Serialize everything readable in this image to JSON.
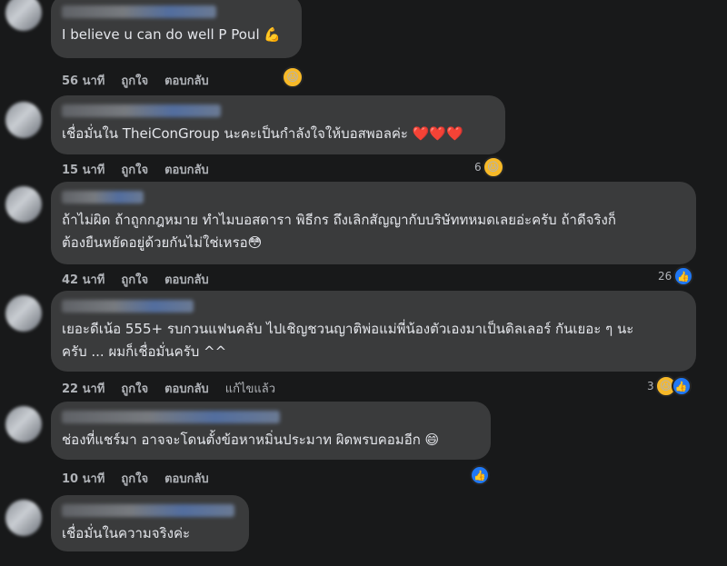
{
  "comments": [
    {
      "text": "I believe u can do well P Poul 💪",
      "time": "56 นาที",
      "like": "ถูกใจ",
      "reply": "ตอบกลับ",
      "reaction_count": ""
    },
    {
      "text": "เชื่อมั่นใน TheiConGroup นะคะเป็นกำลังใจให้บอสพอลค่ะ ❤️❤️❤️",
      "time": "15 นาที",
      "like": "ถูกใจ",
      "reply": "ตอบกลับ",
      "reaction_count": "6"
    },
    {
      "text": "ถ้าไม่ผิด ถ้าถูกกฎหมาย ทำไมบอสดารา พิธีกร ถึงเลิกสัญญากับบริษัททหมดเลยอ่ะครับ ถ้าดีจริงก็\nต้องยืนหยัดอยู่ด้วยกันไม่ใช่เหรอ😳",
      "time": "42 นาที",
      "like": "ถูกใจ",
      "reply": "ตอบกลับ",
      "reaction_count": "26"
    },
    {
      "text": "เยอะดีเน้อ 555+ รบกวนแฟนคลับ ไปเชิญชวนญาติพ่อแม่พี่น้องตัวเองมาเป็นดิลเลอร์ กันเยอะ ๆ นะ\nครับ ... ผมก็เชื่อมั่นครับ ^^",
      "time": "22 นาที",
      "like": "ถูกใจ",
      "reply": "ตอบกลับ",
      "edited": "แก้ไขแล้ว",
      "reaction_count": "3"
    },
    {
      "text": "ช่องที่แชร์มา อาจจะโดนตั้งข้อหาหมิ่นประมาท ผิดพรบคอมอีก 😄",
      "time": "10 นาที",
      "like": "ถูกใจ",
      "reply": "ตอบกลับ",
      "reaction_count": ""
    },
    {
      "text": "เชื่อมั่นในความจริงค่ะ",
      "time": "",
      "like": "",
      "reply": "",
      "reaction_count": ""
    }
  ],
  "icons": {
    "haha": "😆",
    "like": "👍"
  },
  "colors": {
    "background": "#18191a",
    "bubble": "#3a3b3c",
    "text": "#e4e6eb",
    "meta": "#b0b3b8",
    "like_blue": "#2078f4",
    "haha_yellow": "#f7b928"
  }
}
